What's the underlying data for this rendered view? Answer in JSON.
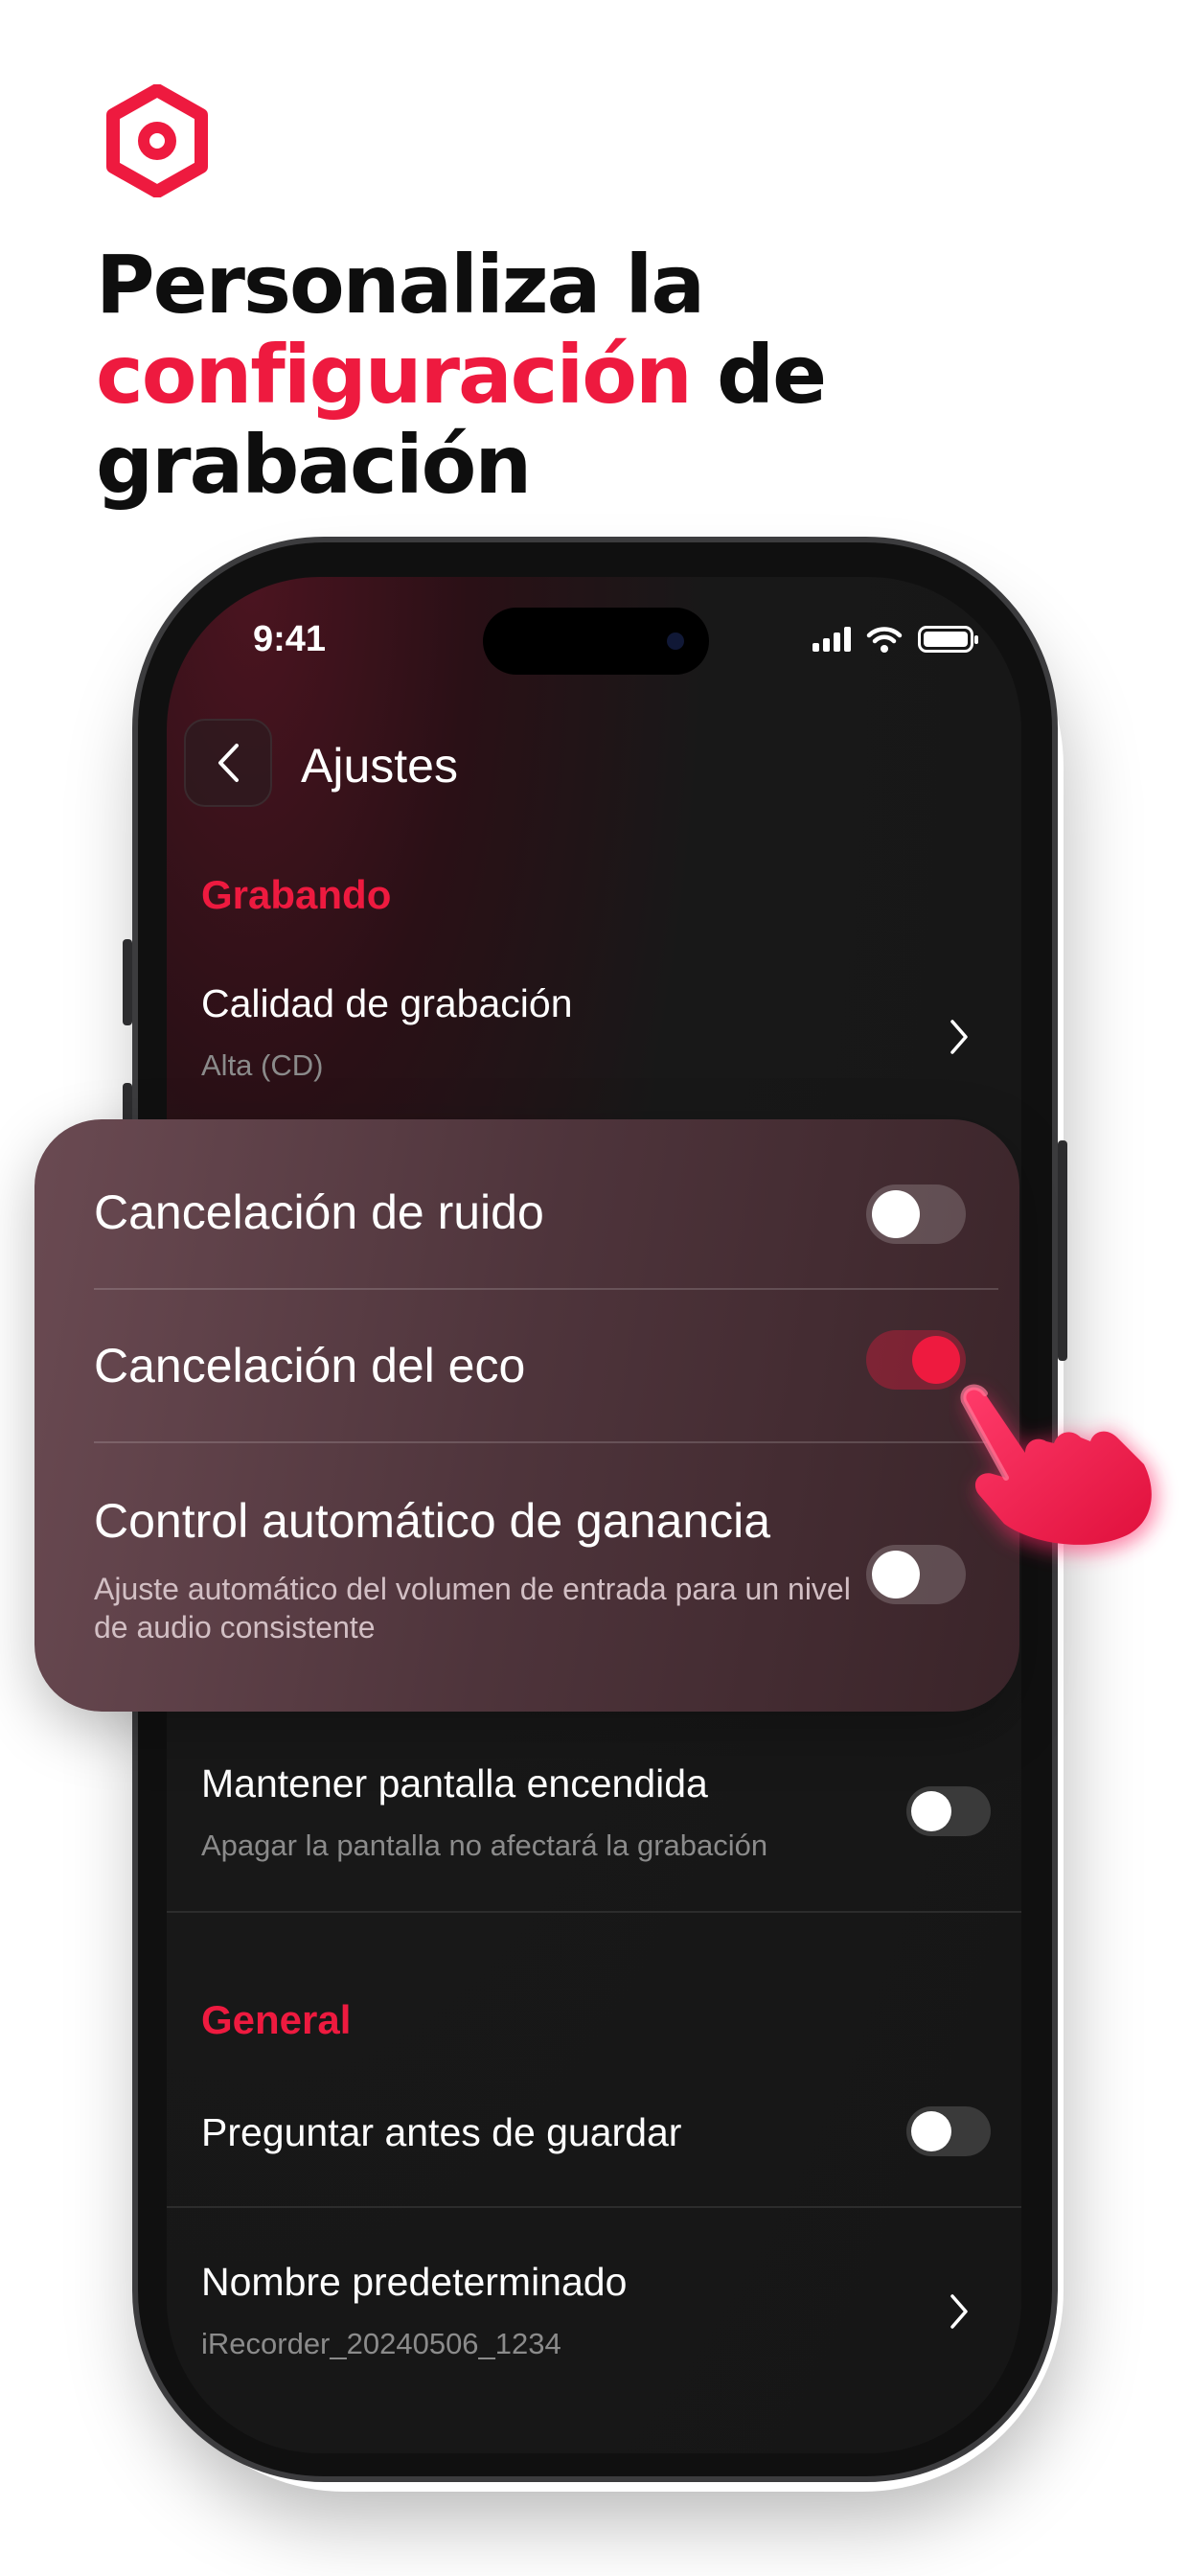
{
  "colors": {
    "accent": "#ee1a3f",
    "screen_bg": "#161616",
    "card_bg": "#5a3d44"
  },
  "headline": {
    "line1": "Personaliza la",
    "accent": "configuración",
    "after_accent": " de",
    "line3": "grabación"
  },
  "status_bar": {
    "time": "9:41",
    "icons": [
      "signal-icon",
      "wifi-icon",
      "battery-icon"
    ]
  },
  "nav": {
    "title": "Ajustes",
    "back_icon": "chevron-left-icon"
  },
  "sections": {
    "recording": "Grabando",
    "general": "General"
  },
  "rows": {
    "quality": {
      "title": "Calidad de grabación",
      "subtitle": "Alta (CD)"
    },
    "screen_on": {
      "title": "Mantener pantalla encendida",
      "subtitle": "Apagar la pantalla no afectará la grabación",
      "enabled": false
    },
    "ask_save": {
      "title": "Preguntar antes de guardar",
      "enabled": false
    },
    "default_name": {
      "title": "Nombre predeterminado",
      "subtitle": "iRecorder_20240506_1234"
    }
  },
  "card": {
    "noise": {
      "title": "Cancelación de ruido",
      "enabled": false
    },
    "echo": {
      "title": "Cancelación del eco",
      "enabled": true
    },
    "gain": {
      "title": "Control automático de ganancia",
      "subtitle": "Ajuste automático del volumen de entrada para un nivel de audio consistente",
      "enabled": false
    }
  }
}
